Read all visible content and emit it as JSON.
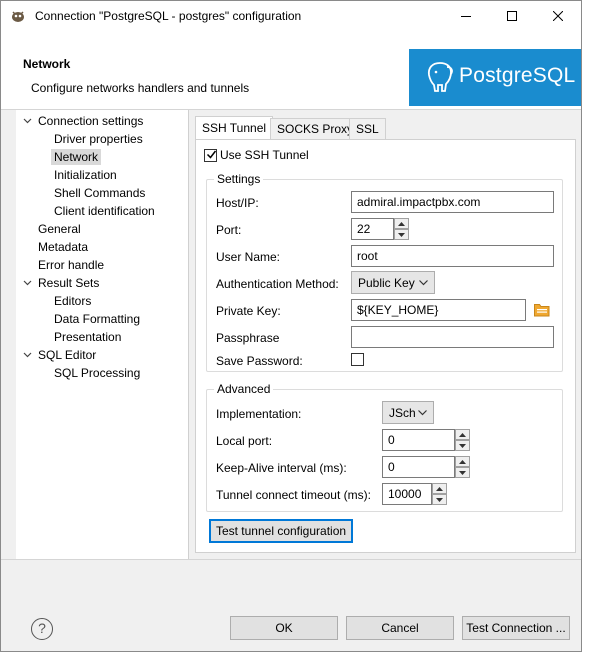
{
  "window": {
    "title": "Connection \"PostgreSQL - postgres\" configuration"
  },
  "header": {
    "title": "Network",
    "subtitle": "Configure networks handlers and tunnels",
    "brand_text": "PostgreSQL",
    "brand_color": "#1a8ccf"
  },
  "sidebar": {
    "connection_settings": "Connection settings",
    "driver_properties": "Driver properties",
    "network": "Network",
    "initialization": "Initialization",
    "shell_commands": "Shell Commands",
    "client_identification": "Client identification",
    "general": "General",
    "metadata": "Metadata",
    "error_handle": "Error handle",
    "result_sets": "Result Sets",
    "editors": "Editors",
    "data_formatting": "Data Formatting",
    "presentation": "Presentation",
    "sql_editor": "SQL Editor",
    "sql_processing": "SQL Processing"
  },
  "tabs": {
    "ssh": "SSH Tunnel",
    "socks": "SOCKS Proxy",
    "ssl": "SSL"
  },
  "ssh": {
    "use_label": "Use SSH Tunnel",
    "use_checked": true,
    "settings_title": "Settings",
    "host_label": "Host/IP:",
    "host_value": "admiral.impactpbx.com",
    "port_label": "Port:",
    "port_value": "22",
    "user_label": "User Name:",
    "user_value": "root",
    "auth_label": "Authentication Method:",
    "auth_value": "Public Key",
    "key_label": "Private Key:",
    "key_value": "${KEY_HOME}",
    "pass_label": "Passphrase",
    "pass_value": "",
    "save_label": "Save Password:",
    "save_checked": false,
    "advanced_title": "Advanced",
    "impl_label": "Implementation:",
    "impl_value": "JSch",
    "local_port_label": "Local port:",
    "local_port_value": "0",
    "keepalive_label": "Keep-Alive interval (ms):",
    "keepalive_value": "0",
    "timeout_label": "Tunnel connect timeout (ms):",
    "timeout_value": "10000",
    "test_button": "Test tunnel configuration"
  },
  "footer": {
    "help": "?",
    "ok": "OK",
    "cancel": "Cancel",
    "test_connection": "Test Connection ..."
  }
}
